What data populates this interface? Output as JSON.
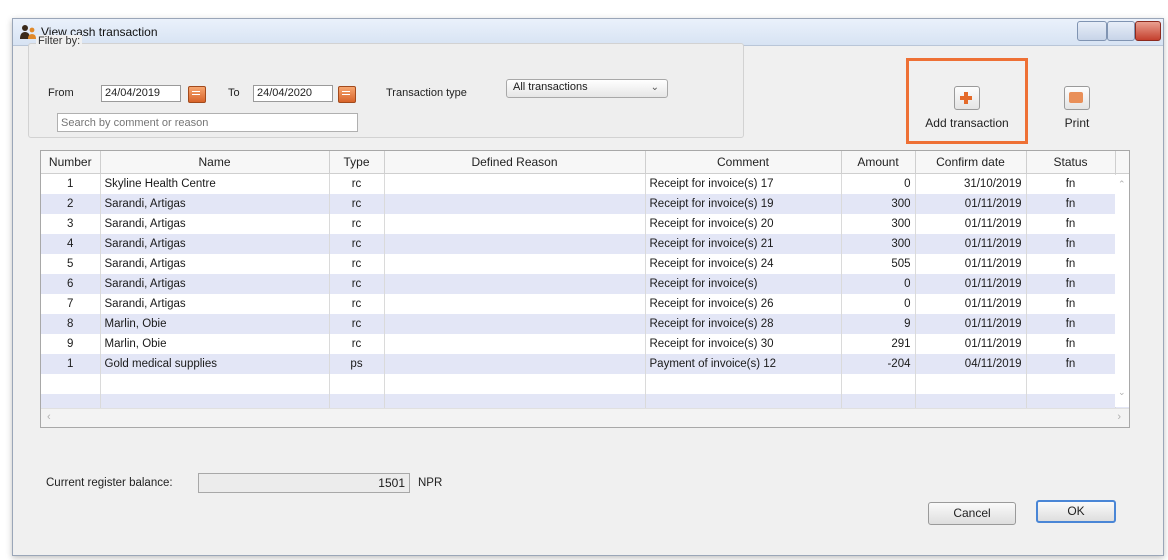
{
  "window": {
    "title": "View cash transaction",
    "icon": "users-icon"
  },
  "filter": {
    "group_label": "Filter by:",
    "from_label": "From",
    "from_value": "24/04/2019",
    "to_label": "To",
    "to_value": "24/04/2020",
    "type_label": "Transaction type",
    "type_selected": "All transactions",
    "search_placeholder": "Search by comment or reason"
  },
  "toolbar": {
    "add_label": "Add transaction",
    "add_icon": "plus-icon",
    "print_label": "Print",
    "print_icon": "printer-icon",
    "highlight_color": "#ee7035"
  },
  "table": {
    "columns": [
      "Number",
      "Name",
      "Type",
      "Defined Reason",
      "Comment",
      "Amount",
      "Confirm date",
      "Status"
    ],
    "rows": [
      {
        "number": "1",
        "name": "Skyline Health Centre",
        "type": "rc",
        "reason": "",
        "comment": "Receipt for invoice(s) 17",
        "amount": "0",
        "date": "31/10/2019",
        "status": "fn"
      },
      {
        "number": "2",
        "name": "Sarandi, Artigas",
        "type": "rc",
        "reason": "",
        "comment": "Receipt for invoice(s) 19",
        "amount": "300",
        "date": "01/11/2019",
        "status": "fn"
      },
      {
        "number": "3",
        "name": "Sarandi, Artigas",
        "type": "rc",
        "reason": "",
        "comment": "Receipt for invoice(s) 20",
        "amount": "300",
        "date": "01/11/2019",
        "status": "fn"
      },
      {
        "number": "4",
        "name": "Sarandi, Artigas",
        "type": "rc",
        "reason": "",
        "comment": "Receipt for invoice(s) 21",
        "amount": "300",
        "date": "01/11/2019",
        "status": "fn"
      },
      {
        "number": "5",
        "name": "Sarandi, Artigas",
        "type": "rc",
        "reason": "",
        "comment": "Receipt for invoice(s) 24",
        "amount": "505",
        "date": "01/11/2019",
        "status": "fn"
      },
      {
        "number": "6",
        "name": "Sarandi, Artigas",
        "type": "rc",
        "reason": "",
        "comment": "Receipt for invoice(s)",
        "amount": "0",
        "date": "01/11/2019",
        "status": "fn"
      },
      {
        "number": "7",
        "name": "Sarandi, Artigas",
        "type": "rc",
        "reason": "",
        "comment": "Receipt for invoice(s) 26",
        "amount": "0",
        "date": "01/11/2019",
        "status": "fn"
      },
      {
        "number": "8",
        "name": "Marlin, Obie",
        "type": "rc",
        "reason": "",
        "comment": "Receipt for invoice(s) 28",
        "amount": "9",
        "date": "01/11/2019",
        "status": "fn"
      },
      {
        "number": "9",
        "name": "Marlin, Obie",
        "type": "rc",
        "reason": "",
        "comment": "Receipt for invoice(s) 30",
        "amount": "291",
        "date": "01/11/2019",
        "status": "fn"
      },
      {
        "number": "1",
        "name": "Gold medical supplies",
        "type": "ps",
        "reason": "",
        "comment": "Payment of invoice(s) 12",
        "amount": "-204",
        "date": "04/11/2019",
        "status": "fn"
      }
    ]
  },
  "footer": {
    "balance_label": "Current register balance:",
    "balance_value": "1501",
    "currency": "NPR",
    "cancel_label": "Cancel",
    "ok_label": "OK"
  }
}
